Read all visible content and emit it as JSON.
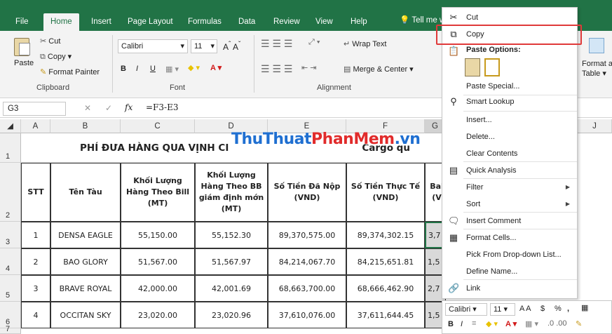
{
  "ribbon_tabs": [
    "File",
    "Home",
    "Insert",
    "Page Layout",
    "Formulas",
    "Data",
    "Review",
    "View",
    "Help"
  ],
  "tell_me": "Tell me wh",
  "clipboard": {
    "cut": "Cut",
    "copy": "Copy",
    "paste": "Paste",
    "format_painter": "Format Painter",
    "label": "Clipboard"
  },
  "font": {
    "name": "Calibri",
    "size": "11",
    "label": "Font",
    "bold": "B",
    "italic": "I",
    "underline": "U"
  },
  "alignment": {
    "wrap_text": "Wrap Text",
    "merge_center": "Merge & Center",
    "label": "Alignment"
  },
  "format_table": {
    "line1": "Format a",
    "line2": "Table"
  },
  "formula_bar": {
    "name_box": "G3",
    "formula": "=F3-E3",
    "fx": "fx"
  },
  "columns": [
    "A",
    "B",
    "C",
    "D",
    "E",
    "F",
    "G",
    "J"
  ],
  "rows": [
    "1",
    "2",
    "3",
    "4",
    "5",
    "6",
    "7"
  ],
  "sheet": {
    "title": "PHÍ ĐƯA HÀNG QUA VỊNH CI",
    "title_tail": "Cargo qu",
    "headers": [
      "STT",
      "Tên Tàu",
      "Khối Lượng Hàng Theo Bill (MT)",
      "Khối Lượng Hàng Theo BB giám định mớn (MT)",
      "Số Tiền Đã Nộp (VND)",
      "Số Tiền Thực Tế (VND)",
      "Bal (V"
    ],
    "data": [
      [
        "1",
        "DENSA EAGLE",
        "55,150.00",
        "55,152.30",
        "89,370,575.00",
        "89,374,302.15",
        "3,7"
      ],
      [
        "2",
        "BAO GLORY",
        "51,567.00",
        "51,567.97",
        "84,214,067.70",
        "84,215,651.81",
        "1,5"
      ],
      [
        "3",
        "BRAVE ROYAL",
        "42,000.00",
        "42,001.69",
        "68,663,700.00",
        "68,666,462.90",
        "2,7"
      ],
      [
        "4",
        "OCCITAN SKY",
        "23,020.00",
        "23,020.96",
        "37,610,076.00",
        "37,611,644.45",
        "1,5"
      ]
    ]
  },
  "watermark": {
    "part1": "ThuThuat",
    "part2": "PhanMem",
    "part3": ".vn"
  },
  "context_menu": {
    "cut": "Cut",
    "copy": "Copy",
    "paste_options": "Paste Options:",
    "paste_special": "Paste Special...",
    "smart_lookup": "Smart Lookup",
    "insert": "Insert...",
    "delete": "Delete...",
    "clear_contents": "Clear Contents",
    "quick_analysis": "Quick Analysis",
    "filter": "Filter",
    "sort": "Sort",
    "insert_comment": "Insert Comment",
    "format_cells": "Format Cells...",
    "pick_from_list": "Pick From Drop-down List...",
    "define_name": "Define Name...",
    "link": "Link"
  },
  "mini_toolbar": {
    "font": "Calibri",
    "size": "11",
    "bold": "B",
    "italic": "I",
    "currency": "$",
    "percent": "%",
    "comma": ","
  },
  "colors": {
    "excel_green": "#217346",
    "highlight": "#e03a3a"
  }
}
